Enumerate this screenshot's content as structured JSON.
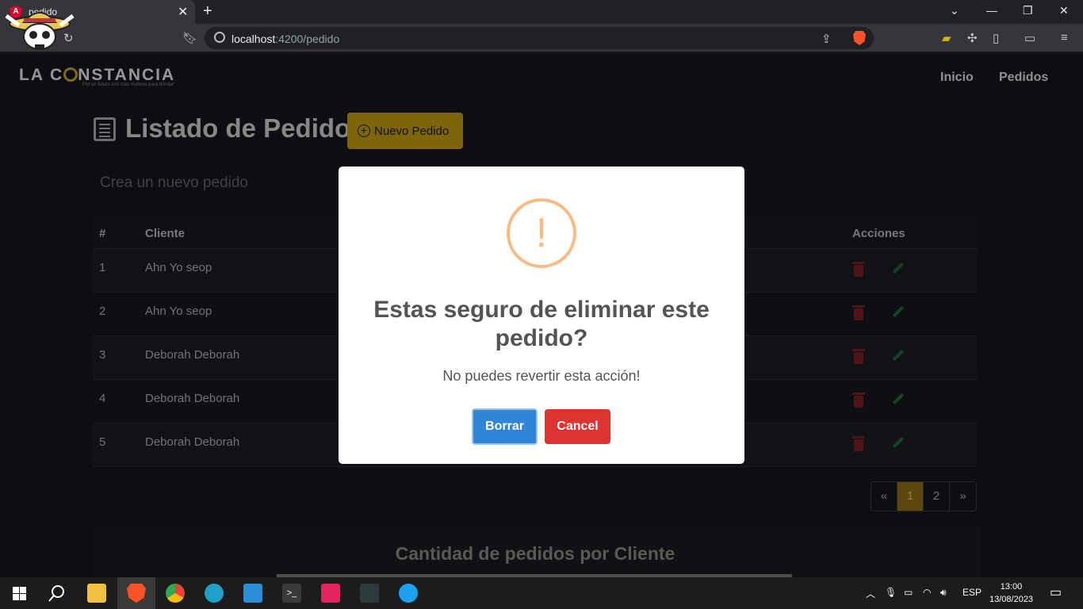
{
  "browser": {
    "tab_title": "pedido",
    "tab_favicon": "A",
    "url_host": "localhost",
    "url_rest": ":4200/pedido"
  },
  "navbar": {
    "brand": "LA CONSTANCIA",
    "brand_pre": "LA C",
    "brand_post": "NSTANCIA",
    "tagline": "Por un futuro con más motivos para brindar",
    "links": [
      "Inicio",
      "Pedidos"
    ]
  },
  "main": {
    "title": "Listado de Pedidos",
    "new_button": "Nuevo Pedido",
    "subtitle": "Crea un nuevo pedido",
    "table": {
      "headers": [
        "#",
        "Cliente",
        "Acciones"
      ],
      "rows": [
        {
          "id": "1",
          "cliente": "Ahn Yo seop"
        },
        {
          "id": "2",
          "cliente": "Ahn Yo seop"
        },
        {
          "id": "3",
          "cliente": "Deborah Deborah"
        },
        {
          "id": "4",
          "cliente": "Deborah Deborah"
        },
        {
          "id": "5",
          "cliente": "Deborah Deborah"
        }
      ]
    },
    "pagination": [
      "«",
      "1",
      "2",
      "»"
    ],
    "chart_card_title": "Cantidad de pedidos por Cliente"
  },
  "modal": {
    "icon": "!",
    "title": "Estas seguro de eliminar este pedido?",
    "text": "No puedes revertir esta acción!",
    "confirm": "Borrar",
    "cancel": "Cancel"
  },
  "taskbar": {
    "lang": "ESP",
    "time": "13:00",
    "date": "13/08/2023"
  },
  "colors": {
    "accent": "#c29b12",
    "confirm": "#3085d6",
    "cancel": "#dd3333",
    "warning": "#f8bb86"
  }
}
